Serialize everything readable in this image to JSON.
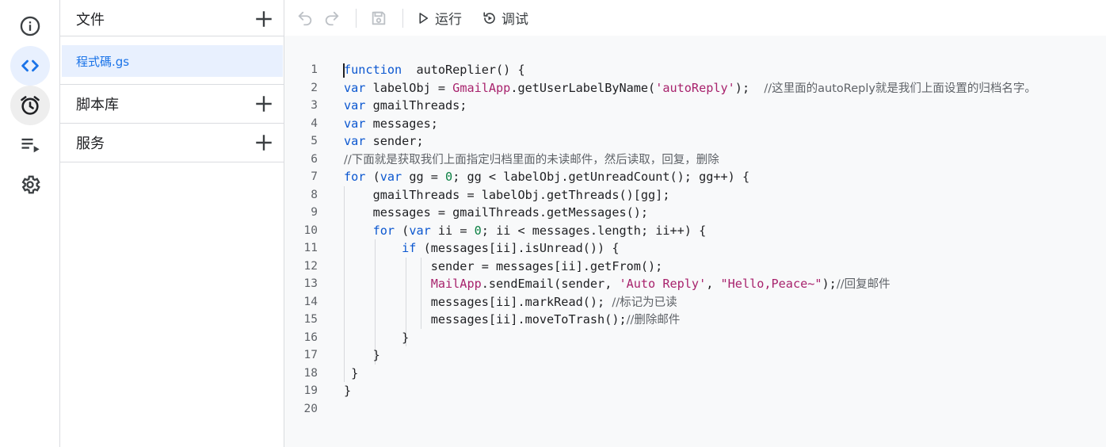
{
  "sidebar": {
    "icons": [
      "info-icon",
      "code-icon",
      "alarm-icon",
      "executions-icon",
      "gear-icon"
    ]
  },
  "files_panel": {
    "files_label": "文件",
    "file_name": "程式碼.gs",
    "libraries_label": "脚本库",
    "services_label": "服务"
  },
  "toolbar": {
    "run_label": "运行",
    "debug_label": "调试"
  },
  "code": {
    "lines": [
      [
        [
          "kw",
          "function"
        ],
        [
          "",
          "  autoReplier() {"
        ]
      ],
      [
        [
          "kw",
          "var"
        ],
        [
          "",
          " labelObj = "
        ],
        [
          "cls",
          "GmailApp"
        ],
        [
          "",
          ".getUserLabelByName("
        ],
        [
          "str",
          "'autoReply'"
        ],
        [
          "",
          ");  "
        ],
        [
          "cmt",
          "//这里面的autoReply就是我们上面设置的归档名字。"
        ]
      ],
      [
        [
          "kw",
          "var"
        ],
        [
          "",
          " gmailThreads;"
        ]
      ],
      [
        [
          "kw",
          "var"
        ],
        [
          "",
          " messages;"
        ]
      ],
      [
        [
          "kw",
          "var"
        ],
        [
          "",
          " sender;"
        ]
      ],
      [
        [
          "cmt",
          "//下面就是获取我们上面指定归档里面的未读邮件，然后读取，回复，删除"
        ]
      ],
      [
        [
          "kw",
          "for"
        ],
        [
          "",
          " ("
        ],
        [
          "kw",
          "var"
        ],
        [
          "",
          " gg = "
        ],
        [
          "num",
          "0"
        ],
        [
          "",
          "; gg < labelObj.getUnreadCount(); gg++) {"
        ]
      ],
      [
        [
          "",
          "    gmailThreads = labelObj.getThreads()[gg];"
        ]
      ],
      [
        [
          "",
          "    messages = gmailThreads.getMessages();"
        ]
      ],
      [
        [
          "",
          "    "
        ],
        [
          "kw",
          "for"
        ],
        [
          "",
          " ("
        ],
        [
          "kw",
          "var"
        ],
        [
          "",
          " ii = "
        ],
        [
          "num",
          "0"
        ],
        [
          "",
          "; ii < messages.length; ii++) {"
        ]
      ],
      [
        [
          "",
          "        "
        ],
        [
          "kw",
          "if"
        ],
        [
          "",
          " (messages[ii].isUnread()) {"
        ]
      ],
      [
        [
          "",
          "            sender = messages[ii].getFrom();"
        ]
      ],
      [
        [
          "",
          "            "
        ],
        [
          "cls",
          "MailApp"
        ],
        [
          "",
          ".sendEmail(sender, "
        ],
        [
          "str",
          "'Auto Reply'"
        ],
        [
          "",
          ", "
        ],
        [
          "str",
          "\"Hello,Peace~\""
        ],
        [
          "",
          ");"
        ],
        [
          "cmt",
          "//回复邮件"
        ]
      ],
      [
        [
          "",
          "            messages[ii].markRead(); "
        ],
        [
          "cmt",
          "//标记为已读"
        ]
      ],
      [
        [
          "",
          "            messages[ii].moveToTrash();"
        ],
        [
          "cmt",
          "//删除邮件"
        ]
      ],
      [
        [
          "",
          "        }"
        ]
      ],
      [
        [
          "",
          "    }"
        ]
      ],
      [
        [
          "",
          " }"
        ]
      ],
      [
        [
          "",
          "}"
        ]
      ],
      [
        [
          "",
          ""
        ]
      ]
    ]
  }
}
